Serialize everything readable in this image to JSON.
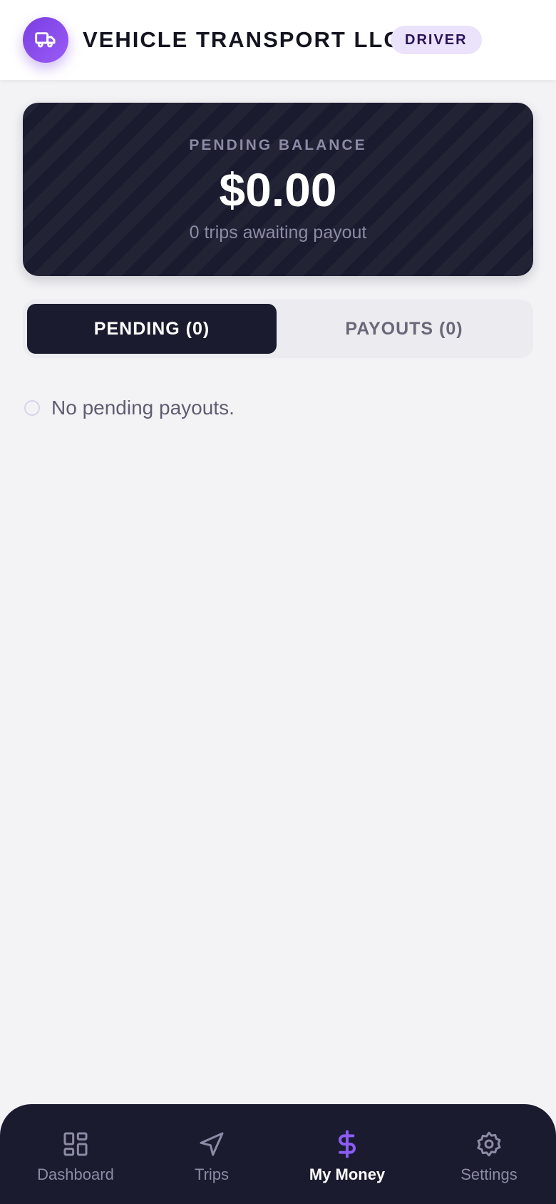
{
  "header": {
    "title": "VEHICLE TRANSPORT LLC",
    "role_badge": "DRIVER",
    "logo_icon": "truck-icon"
  },
  "balance": {
    "label": "PENDING BALANCE",
    "amount": "$0.00",
    "subtitle": "0 trips awaiting payout"
  },
  "tabs": [
    {
      "label": "PENDING (0)",
      "active": true
    },
    {
      "label": "PAYOUTS (0)",
      "active": false
    }
  ],
  "empty_state": {
    "text": "No pending payouts."
  },
  "nav": [
    {
      "label": "Dashboard",
      "icon": "dashboard-icon",
      "active": false
    },
    {
      "label": "Trips",
      "icon": "navigation-icon",
      "active": false
    },
    {
      "label": "My Money",
      "icon": "dollar-icon",
      "active": true
    },
    {
      "label": "Settings",
      "icon": "gear-icon",
      "active": false
    }
  ],
  "colors": {
    "accent": "#8b5cf6",
    "dark": "#1b1b2f",
    "background": "#f3f3f6",
    "badge_bg": "#ebe2fb"
  }
}
